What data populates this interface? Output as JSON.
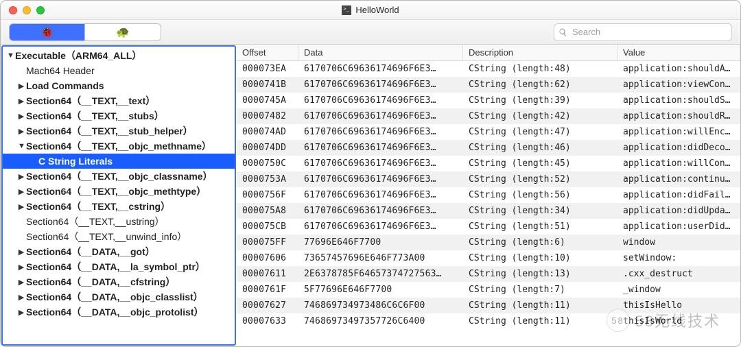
{
  "window": {
    "title": "HelloWorld"
  },
  "toolbar": {
    "segments": [
      {
        "icon": "🐞",
        "active": true
      },
      {
        "icon": "🐢",
        "active": false
      }
    ],
    "search_placeholder": "Search"
  },
  "sidebar": {
    "items": [
      {
        "label": "Executable（ARM64_ALL）",
        "indent": 0,
        "disclosure": "open",
        "bold": true,
        "selected": false
      },
      {
        "label": "Mach64 Header",
        "indent": 1,
        "disclosure": "none",
        "bold": false,
        "selected": false
      },
      {
        "label": "Load Commands",
        "indent": 1,
        "disclosure": "closed",
        "bold": true,
        "selected": false
      },
      {
        "label": "Section64（__TEXT,__text）",
        "indent": 1,
        "disclosure": "closed",
        "bold": true,
        "selected": false
      },
      {
        "label": "Section64（__TEXT,__stubs）",
        "indent": 1,
        "disclosure": "closed",
        "bold": true,
        "selected": false
      },
      {
        "label": "Section64（__TEXT,__stub_helper）",
        "indent": 1,
        "disclosure": "closed",
        "bold": true,
        "selected": false
      },
      {
        "label": "Section64（__TEXT,__objc_methname）",
        "indent": 1,
        "disclosure": "open",
        "bold": true,
        "selected": false
      },
      {
        "label": "C String Literals",
        "indent": 2,
        "disclosure": "none",
        "bold": true,
        "selected": true
      },
      {
        "label": "Section64（__TEXT,__objc_classname）",
        "indent": 1,
        "disclosure": "closed",
        "bold": true,
        "selected": false
      },
      {
        "label": "Section64（__TEXT,__objc_methtype）",
        "indent": 1,
        "disclosure": "closed",
        "bold": true,
        "selected": false
      },
      {
        "label": "Section64（__TEXT,__cstring）",
        "indent": 1,
        "disclosure": "closed",
        "bold": true,
        "selected": false
      },
      {
        "label": "Section64（__TEXT,__ustring）",
        "indent": 1,
        "disclosure": "none",
        "bold": false,
        "selected": false
      },
      {
        "label": "Section64（__TEXT,__unwind_info）",
        "indent": 1,
        "disclosure": "none",
        "bold": false,
        "selected": false
      },
      {
        "label": "Section64（__DATA,__got）",
        "indent": 1,
        "disclosure": "closed",
        "bold": true,
        "selected": false
      },
      {
        "label": "Section64（__DATA,__la_symbol_ptr）",
        "indent": 1,
        "disclosure": "closed",
        "bold": true,
        "selected": false
      },
      {
        "label": "Section64（__DATA,__cfstring）",
        "indent": 1,
        "disclosure": "closed",
        "bold": true,
        "selected": false
      },
      {
        "label": "Section64（__DATA,__objc_classlist）",
        "indent": 1,
        "disclosure": "closed",
        "bold": true,
        "selected": false
      },
      {
        "label": "Section64（__DATA,__objc_protolist）",
        "indent": 1,
        "disclosure": "closed",
        "bold": true,
        "selected": false
      }
    ]
  },
  "table": {
    "columns": {
      "offset": "Offset",
      "data": "Data",
      "description": "Description",
      "value": "Value"
    },
    "rows": [
      {
        "offset": "000073EA",
        "data": "6170706C69636174696F6E3…",
        "description": "CString (length:48)",
        "value": "application:shouldAllo…"
      },
      {
        "offset": "0000741B",
        "data": "6170706C69636174696F6E3…",
        "description": "CString (length:62)",
        "value": "application:viewContro…"
      },
      {
        "offset": "0000745A",
        "data": "6170706C69636174696F6E3…",
        "description": "CString (length:39)",
        "value": "application:shouldSave…"
      },
      {
        "offset": "00007482",
        "data": "6170706C69636174696F6E3…",
        "description": "CString (length:42)",
        "value": "application:shouldRest…"
      },
      {
        "offset": "000074AD",
        "data": "6170706C69636174696F6E3…",
        "description": "CString (length:47)",
        "value": "application:willEncode…"
      },
      {
        "offset": "000074DD",
        "data": "6170706C69636174696F6E3…",
        "description": "CString (length:46)",
        "value": "application:didDecodeR…"
      },
      {
        "offset": "0000750C",
        "data": "6170706C69636174696F6E3…",
        "description": "CString (length:45)",
        "value": "application:willContin…"
      },
      {
        "offset": "0000753A",
        "data": "6170706C69636174696F6E3…",
        "description": "CString (length:52)",
        "value": "application:continueUs…"
      },
      {
        "offset": "0000756F",
        "data": "6170706C69636174696F6E3…",
        "description": "CString (length:56)",
        "value": "application:didFailToC…"
      },
      {
        "offset": "000075A8",
        "data": "6170706C69636174696F6E3…",
        "description": "CString (length:34)",
        "value": "application:didUpdateU…"
      },
      {
        "offset": "000075CB",
        "data": "6170706C69636174696F6E3…",
        "description": "CString (length:51)",
        "value": "application:userDidAcc…"
      },
      {
        "offset": "000075FF",
        "data": "77696E646F7700",
        "description": "CString (length:6)",
        "value": "window"
      },
      {
        "offset": "00007606",
        "data": "73657457696E646F773A00",
        "description": "CString (length:10)",
        "value": "setWindow:"
      },
      {
        "offset": "00007611",
        "data": "2E6378785F64657374727563…",
        "description": "CString (length:13)",
        "value": ".cxx_destruct"
      },
      {
        "offset": "0000761F",
        "data": "5F77696E646F7700",
        "description": "CString (length:7)",
        "value": "_window"
      },
      {
        "offset": "00007627",
        "data": "746869734973486C6C6F00",
        "description": "CString (length:11)",
        "value": "thisIsHello"
      },
      {
        "offset": "00007633",
        "data": "74686973497357726C6400",
        "description": "CString (length:11)",
        "value": "thisIsWorld"
      }
    ]
  },
  "watermark": "58无线技术"
}
